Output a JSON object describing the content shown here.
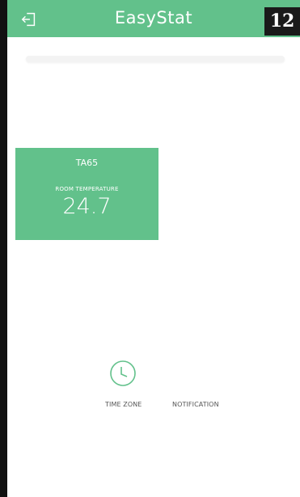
{
  "header": {
    "title": "EasyStat",
    "badge": "12",
    "accent_color": "#62c18b",
    "icons": {
      "exit": "exit-icon"
    }
  },
  "search": {
    "placeholder": ""
  },
  "card": {
    "device": "TA65",
    "label": "ROOM TEMPERATURE",
    "value": "24.7",
    "color": "#62c18b"
  },
  "controls": {
    "time_zone_label": "TIME ZONE",
    "notification_label": "NOTIFICATION",
    "icons": {
      "time_zone": "clock-icon"
    }
  }
}
